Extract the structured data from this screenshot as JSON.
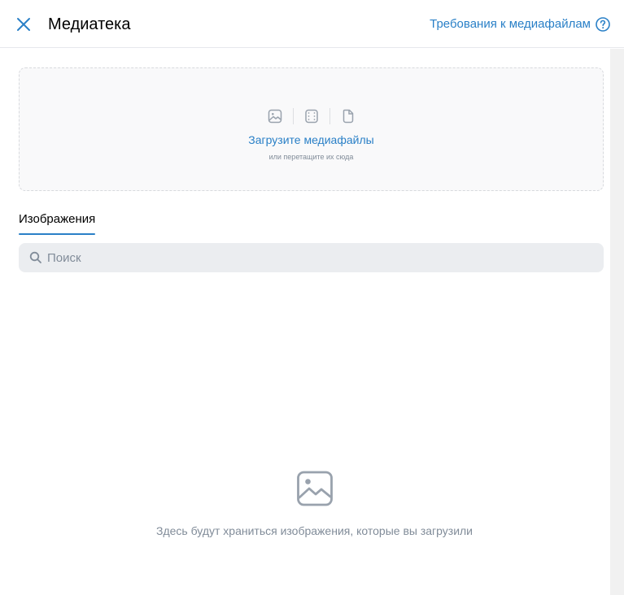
{
  "header": {
    "title": "Медиатека",
    "requirements_link": "Требования к медиафайлам",
    "close_icon": "close-icon",
    "help_icon": "help-circle-icon"
  },
  "upload": {
    "title": "Загрузите медиафайлы",
    "subtitle": "или перетащите их сюда",
    "icons": [
      "image-icon",
      "video-icon",
      "file-icon"
    ]
  },
  "tabs": [
    {
      "label": "Изображения",
      "active": true
    }
  ],
  "search": {
    "placeholder": "Поиск",
    "value": ""
  },
  "empty_state": {
    "icon": "image-icon",
    "text": "Здесь будут храниться изображения, которые вы загрузили"
  },
  "colors": {
    "accent": "#2a80c7",
    "secondary_text": "#818c99",
    "search_bg": "#ebedf0",
    "upload_bg": "#f9f9fa"
  }
}
